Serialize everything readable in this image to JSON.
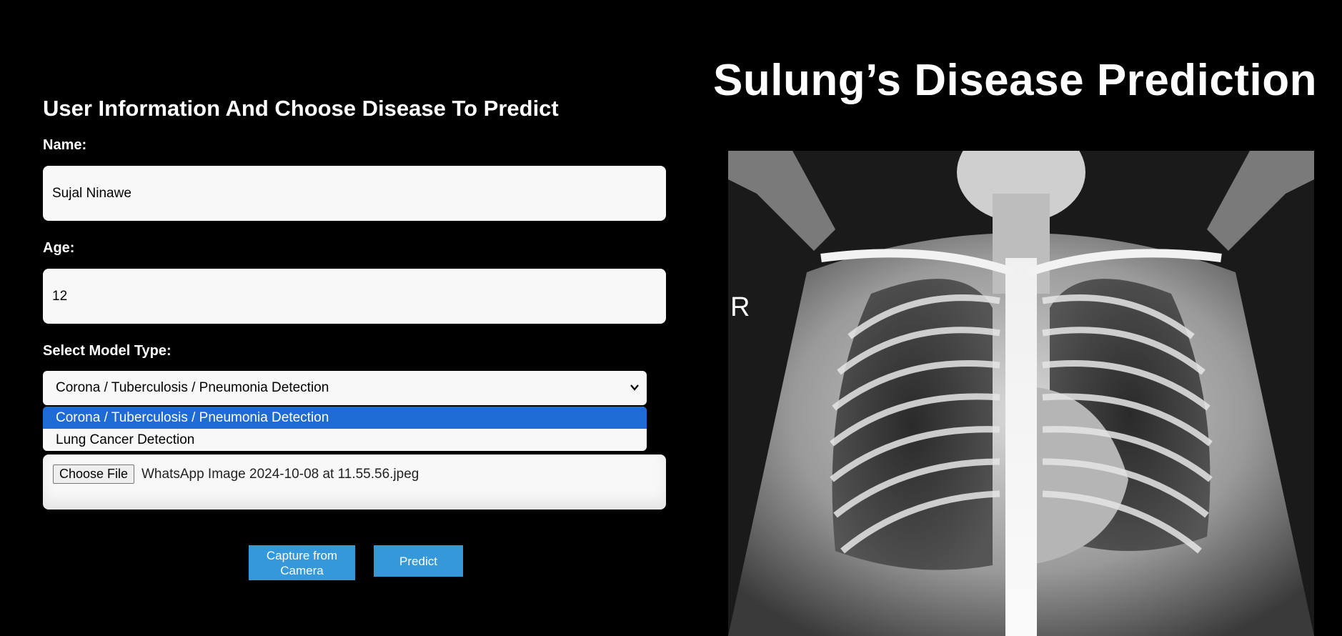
{
  "form": {
    "title": "User Information And Choose Disease To Predict",
    "name_label": "Name:",
    "name_value": "Sujal Ninawe",
    "age_label": "Age:",
    "age_value": "12",
    "model_label": "Select Model Type:",
    "model_selected": "Corona / Tuberculosis / Pneumonia Detection",
    "model_options": [
      "Corona / Tuberculosis / Pneumonia Detection",
      "Lung Cancer Detection"
    ],
    "file_button_label": "Choose File",
    "file_name": "WhatsApp Image 2024-10-08 at 11.55.56.jpeg",
    "capture_button_label": "Capture from Camera",
    "predict_button_label": "Predict"
  },
  "app_title": "Sulung’s Disease Prediction",
  "xray": {
    "marker": "R"
  },
  "colors": {
    "background": "#000000",
    "accent_button": "#3498db",
    "selected_option": "#1e6bd6",
    "field_background": "#f8f8f8"
  },
  "icons": {
    "select_arrow": "chevron-down-icon"
  }
}
